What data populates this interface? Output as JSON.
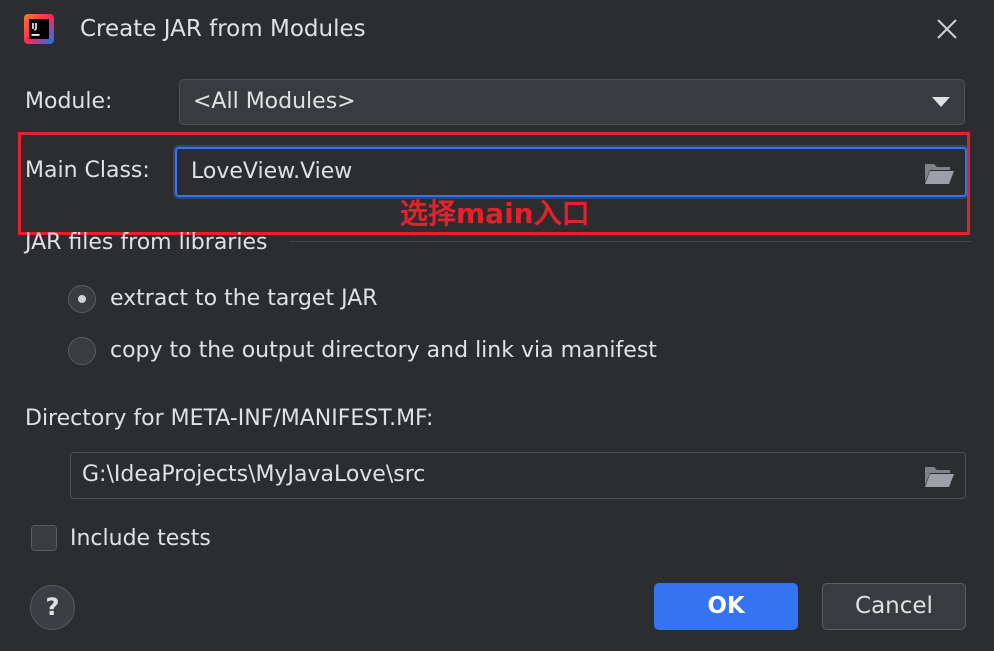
{
  "window": {
    "title": "Create JAR from Modules",
    "logo_text": "IJ"
  },
  "module": {
    "label": "Module:",
    "selected": "<All Modules>"
  },
  "main_class": {
    "label": "Main Class:",
    "value": "LoveView.View"
  },
  "annotation": {
    "text": "选择main入口",
    "color": "#e5222a"
  },
  "jar_files": {
    "section_title": "JAR files from libraries",
    "options": [
      {
        "label": "extract to the target JAR",
        "selected": true
      },
      {
        "label": "copy to the output directory and link via manifest",
        "selected": false
      }
    ]
  },
  "manifest": {
    "label": "Directory for META-INF/MANIFEST.MF:",
    "value": "G:\\IdeaProjects\\MyJavaLove\\src"
  },
  "include_tests": {
    "label": "Include tests",
    "checked": false
  },
  "buttons": {
    "help": "?",
    "ok": "OK",
    "cancel": "Cancel"
  },
  "colors": {
    "background": "#2b2d30",
    "accent": "#3574f0",
    "text": "#dfe1e5"
  }
}
